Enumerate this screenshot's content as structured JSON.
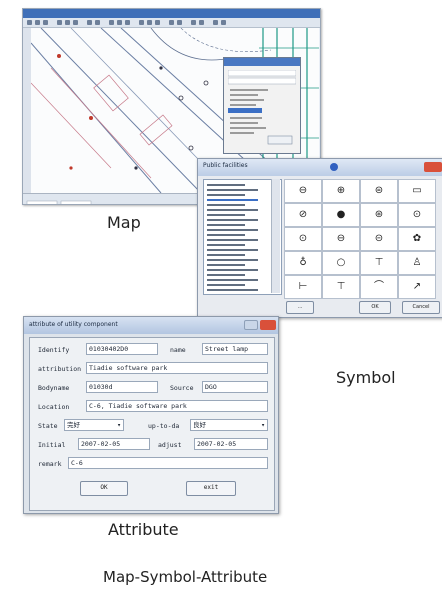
{
  "captions": {
    "map": "Map",
    "symbol": "Symbol",
    "attribute": "Attribute",
    "footer": "Map-Symbol-Attribute"
  },
  "symbol_window": {
    "title": "Public facilities",
    "list_item_count": 22,
    "symbol_glyphs": [
      "⊖",
      "⊕",
      "⊜",
      "▭",
      "⊘",
      "●",
      "⊛",
      "⊙",
      "⊙",
      "⊖",
      "⊝",
      "✿",
      "♁",
      "○",
      "⊤",
      "♙",
      "⊢",
      "⊤",
      "⌒",
      "↗"
    ],
    "buttons": {
      "left": "...",
      "ok": "OK",
      "cancel": "Cancel"
    }
  },
  "attribute_window": {
    "title": "attribute of utility component",
    "fields": {
      "identify_label": "Identify",
      "identify_value": "01030402D0",
      "name_label": "name",
      "name_value": "Street lamp",
      "attribution_label": "attribution",
      "attribution_value": "Tiadie software park",
      "bodyname_label": "Bodyname",
      "bodyname_value": "01030d",
      "source_label": "Source",
      "source_value": "DGO",
      "location_label": "Location",
      "location_value": "C-6, Tiadie software park",
      "state_label": "State",
      "state_value": "完好",
      "upto_label": "up-to-da",
      "upto_value": "良好",
      "initial_label": "Initial",
      "initial_value": "2007-02-05",
      "adjust_label": "adjust",
      "adjust_value": "2007-02-05",
      "remark_label": "remark",
      "remark_value": "C-6"
    },
    "buttons": {
      "ok": "OK",
      "exit": "exit"
    }
  },
  "colors": {
    "titlebar_blue": "#3f6fb8",
    "close_red": "#d9503a",
    "map_pipe_teal": "#1f9a86"
  }
}
